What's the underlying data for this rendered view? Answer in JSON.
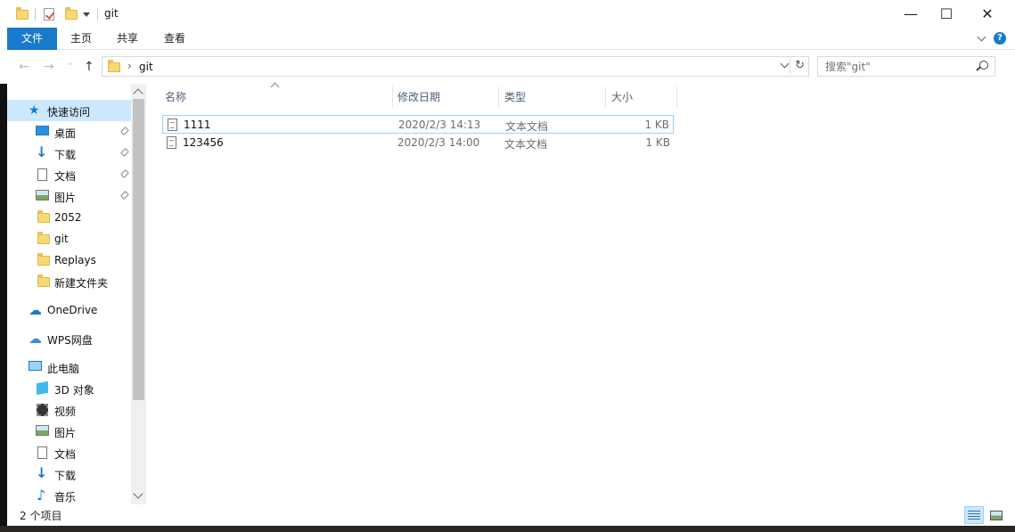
{
  "window": {
    "title": "git",
    "controls": {
      "minimize": "—",
      "maximize": "☐",
      "close": "✕"
    }
  },
  "ribbon": {
    "tabs": [
      {
        "label": "文件"
      },
      {
        "label": "主页"
      },
      {
        "label": "共享"
      },
      {
        "label": "查看"
      }
    ],
    "help": "?"
  },
  "nav": {
    "back": "←",
    "forward": "→",
    "recent": "˅",
    "up": "↑",
    "breadcrumb_sep": "›",
    "path": "git",
    "refresh": "↻",
    "search_placeholder": "搜索\"git\""
  },
  "sidebar": {
    "items": [
      {
        "label": "快速访问",
        "icon": "star-icon"
      },
      {
        "label": "桌面",
        "icon": "desktop-icon",
        "pinned": true
      },
      {
        "label": "下载",
        "icon": "download-icon",
        "pinned": true
      },
      {
        "label": "文档",
        "icon": "document-icon",
        "pinned": true
      },
      {
        "label": "图片",
        "icon": "picture-icon",
        "pinned": true
      },
      {
        "label": "2052",
        "icon": "folder-icon"
      },
      {
        "label": "git",
        "icon": "folder-icon"
      },
      {
        "label": "Replays",
        "icon": "folder-icon"
      },
      {
        "label": "新建文件夹",
        "icon": "folder-icon"
      },
      {
        "label": "OneDrive",
        "icon": "cloud-icon"
      },
      {
        "label": "WPS网盘",
        "icon": "cloud-outline-icon"
      },
      {
        "label": "此电脑",
        "icon": "computer-icon"
      },
      {
        "label": "3D 对象",
        "icon": "cube-icon"
      },
      {
        "label": "视频",
        "icon": "film-icon"
      },
      {
        "label": "图片",
        "icon": "picture-icon"
      },
      {
        "label": "文档",
        "icon": "document-icon"
      },
      {
        "label": "下载",
        "icon": "download-icon"
      },
      {
        "label": "音乐",
        "icon": "music-icon"
      }
    ]
  },
  "list": {
    "columns": [
      {
        "label": "名称"
      },
      {
        "label": "修改日期"
      },
      {
        "label": "类型"
      },
      {
        "label": "大小"
      }
    ],
    "rows": [
      {
        "name": "1111",
        "modified": "2020/2/3 14:13",
        "type": "文本文档",
        "size": "1 KB"
      },
      {
        "name": "123456",
        "modified": "2020/2/3 14:00",
        "type": "文本文档",
        "size": "1 KB"
      }
    ]
  },
  "status": {
    "count": "2 个项目"
  }
}
